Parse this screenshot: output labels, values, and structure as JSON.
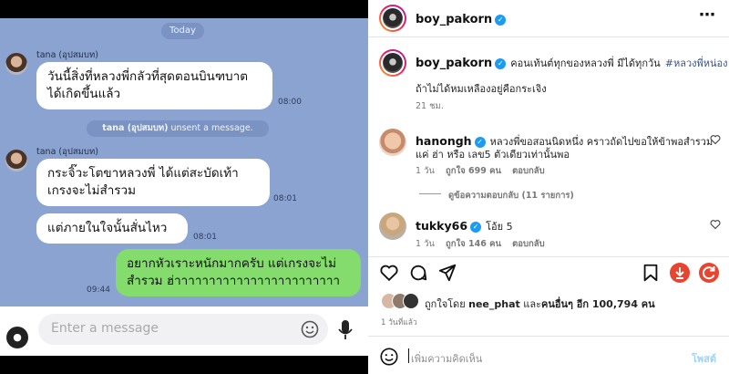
{
  "chat": {
    "date_label": "Today",
    "messages": [
      {
        "sender": "tana (อุปสมบท)",
        "lines": [
          "วันนี้สิ่งที่หลวงพี่กลัวที่สุดตอนบินฑบาต",
          "ได้เกิดขึ้นแล้ว"
        ],
        "time": "08:00"
      },
      {
        "system": "unsent a message.",
        "system_sender": "tana (อุปสมบท)"
      },
      {
        "sender": "tana (อุปสมบท)",
        "lines": [
          "กระจิ๊วะโตขาหลวงพี่ ได้แต่สะบัดเท้า",
          "เกรงจะไม่สำรวม"
        ],
        "time": "08:01"
      },
      {
        "lines": [
          "แต่ภายในใจนั้นสั่นไหว"
        ],
        "time": "08:01"
      },
      {
        "lines": [
          "อยากหัวเราะหนักมากครับ แต่เกรงจะไม่",
          "สำรวม ฮ่าาาาาาาาาาาาาาาาาาาาาาาา"
        ],
        "time": "09:44",
        "own": true
      }
    ],
    "input_placeholder": "Enter a message"
  },
  "instagram": {
    "header_username": "boy_pakorn",
    "more_icon": "more-horizontal-icon",
    "caption": {
      "username": "boy_pakorn",
      "text": "คอนเท้นต์ทุกของหลวงพี่ มีได้ทุกวัน",
      "hashtag": "#หลวงพี่หน่อง",
      "line2": "ถ้าไม่ได้หมเหลืองอยู่คือกระเจิง",
      "time": "21 ชม."
    },
    "comments": [
      {
        "username": "hanongh",
        "verified": true,
        "text_line1": "หลวงพี่ขอสอนนิดหนึ่ง คราวถัดไปขอให้ข้าพอสำรวม",
        "text_line2": "แค่ ฮ่า หรือ เลข5 ตัวเดียวเท่านั้นพอ",
        "age": "1 วัน",
        "likes": "ถูกใจ 699 คน",
        "reply": "ตอบกลับ",
        "view_replies": "ดูข้อความตอบกลับ (11 รายการ)"
      },
      {
        "username": "tukky66",
        "verified": true,
        "text": "โอ้ย 5",
        "age": "1 วัน",
        "likes": "ถูกใจ 146 คน",
        "reply": "ตอบกลับ"
      }
    ],
    "liked_by": {
      "prefix": "ถูกใจโดย",
      "user": "nee_phat",
      "mid": "และ",
      "others": "คนอื่นๆ อีก 100,794 คน"
    },
    "post_age": "1 วันที่แล้ว",
    "comment_placeholder": "เพิ่มความคิดเห็น",
    "post_button": "โพสต์",
    "accent": "#0095f6"
  }
}
